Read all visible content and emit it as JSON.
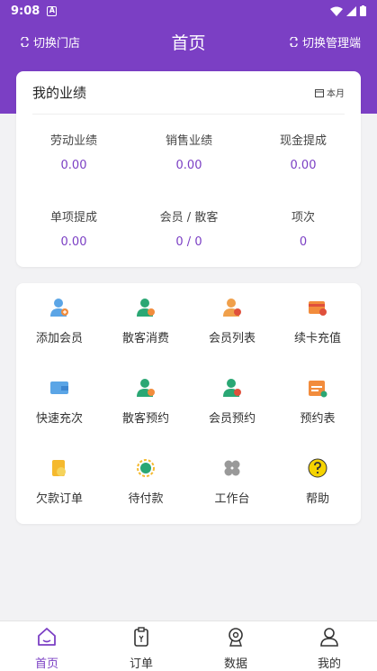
{
  "status_bar": {
    "time": "9:08",
    "notif_letter": "A"
  },
  "header": {
    "left_label": "切换门店",
    "title": "首页",
    "right_label": "切换管理端"
  },
  "performance": {
    "title": "我的业绩",
    "period": "本月",
    "stats": [
      {
        "label": "劳动业绩",
        "value": "0.00"
      },
      {
        "label": "销售业绩",
        "value": "0.00"
      },
      {
        "label": "现金提成",
        "value": "0.00"
      },
      {
        "label": "单项提成",
        "value": "0.00"
      },
      {
        "label": "会员 / 散客",
        "value": "0 / 0"
      },
      {
        "label": "项次",
        "value": "0"
      }
    ]
  },
  "functions": [
    {
      "label": "添加会员",
      "icon": "add-member-icon"
    },
    {
      "label": "散客消费",
      "icon": "walkin-consume-icon"
    },
    {
      "label": "会员列表",
      "icon": "member-list-icon"
    },
    {
      "label": "续卡充值",
      "icon": "card-recharge-icon"
    },
    {
      "label": "快速充次",
      "icon": "quick-recharge-icon"
    },
    {
      "label": "散客预约",
      "icon": "walkin-appointment-icon"
    },
    {
      "label": "会员预约",
      "icon": "member-appointment-icon"
    },
    {
      "label": "预约表",
      "icon": "appointment-table-icon"
    },
    {
      "label": "欠款订单",
      "icon": "debt-order-icon"
    },
    {
      "label": "待付款",
      "icon": "pending-payment-icon"
    },
    {
      "label": "工作台",
      "icon": "workbench-icon"
    },
    {
      "label": "帮助",
      "icon": "help-icon"
    }
  ],
  "tabs": [
    {
      "label": "首页",
      "icon": "home-icon",
      "active": true
    },
    {
      "label": "订单",
      "icon": "order-icon",
      "active": false
    },
    {
      "label": "数据",
      "icon": "data-icon",
      "active": false
    },
    {
      "label": "我的",
      "icon": "profile-icon",
      "active": false
    }
  ],
  "colors": {
    "accent": "#7b3fc4",
    "background": "#f2f2f4",
    "card": "#ffffff"
  }
}
